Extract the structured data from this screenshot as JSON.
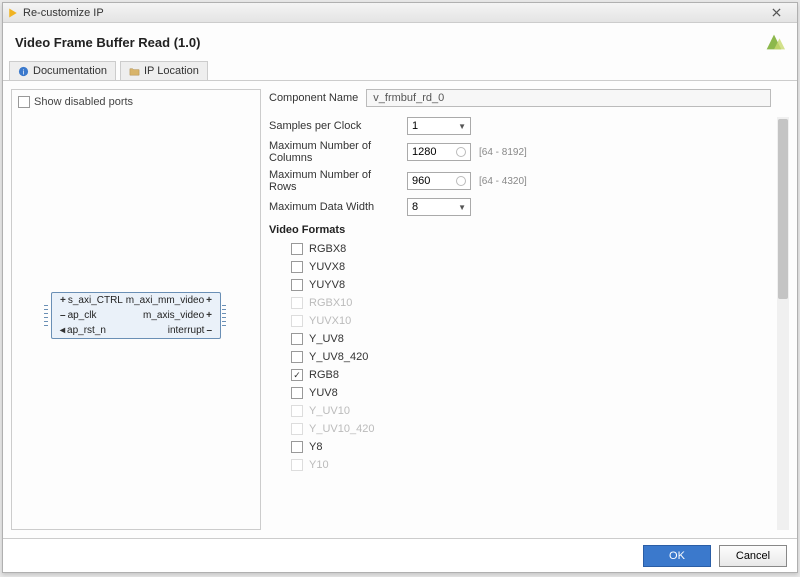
{
  "window": {
    "title": "Re-customize IP"
  },
  "header": {
    "title": "Video Frame Buffer Read (1.0)"
  },
  "tabs": {
    "doc": "Documentation",
    "iploc": "IP Location"
  },
  "left": {
    "show_disabled": "Show disabled ports",
    "ip": {
      "p0l": "s_axi_CTRL",
      "p0r": "m_axi_mm_video",
      "p1l": "ap_clk",
      "p1r": "m_axis_video",
      "p2l": "ap_rst_n",
      "p2r": "interrupt"
    }
  },
  "right": {
    "component_label": "Component Name",
    "component_value": "v_frmbuf_rd_0",
    "params": {
      "spc": {
        "label": "Samples per Clock",
        "value": "1"
      },
      "cols": {
        "label": "Maximum Number of Columns",
        "value": "1280",
        "range": "[64 - 8192]"
      },
      "rows": {
        "label": "Maximum Number of Rows",
        "value": "960",
        "range": "[64 - 4320]"
      },
      "dw": {
        "label": "Maximum Data Width",
        "value": "8"
      }
    },
    "vf_title": "Video Formats",
    "formats": {
      "f0": "RGBX8",
      "f1": "YUVX8",
      "f2": "YUYV8",
      "f3": "RGBX10",
      "f4": "YUVX10",
      "f5": "Y_UV8",
      "f6": "Y_UV8_420",
      "f7": "RGB8",
      "f8": "YUV8",
      "f9": "Y_UV10",
      "f10": "Y_UV10_420",
      "f11": "Y8",
      "f12": "Y10"
    }
  },
  "footer": {
    "ok": "OK",
    "cancel": "Cancel"
  }
}
